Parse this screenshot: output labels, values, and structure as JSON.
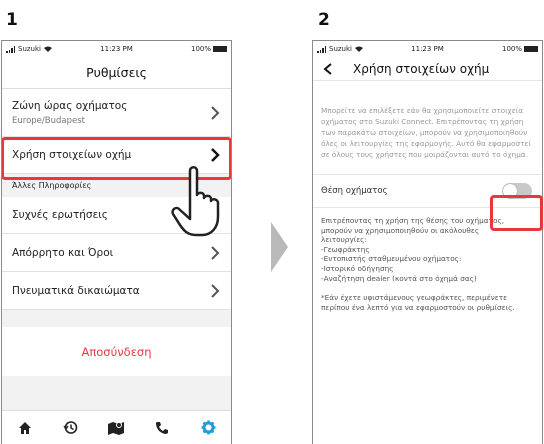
{
  "steps": [
    "1",
    "2"
  ],
  "status_bar": {
    "carrier": "Suzuki",
    "time": "11:23 PM",
    "battery": "100%"
  },
  "screen1": {
    "title": "Ρυθμίσεις",
    "timezone": {
      "label": "Ζώνη ώρας οχήματος",
      "value": "Europe/Budapest"
    },
    "vehicle_data": {
      "label": "Χρήση στοιχείων οχήμ"
    },
    "section_label": "Άλλες Πληροφορίες",
    "items": [
      {
        "label": "Συχνές ερωτήσεις"
      },
      {
        "label": "Απόρρητο και Όροι"
      },
      {
        "label": "Πνευματικά δικαιώματα"
      }
    ],
    "logout": "Αποσύνδεση",
    "tabs": [
      "home-icon",
      "history-icon",
      "map-icon",
      "phone-icon",
      "settings-icon"
    ],
    "colors": {
      "accent": "#e8383d",
      "active_tab": "#1aa0d8"
    }
  },
  "screen2": {
    "title": "Χρήση στοιχείων οχήμ",
    "intro": "Μπορείτε να επιλέξετε εάν θα χρησιμοποιείτε στοιχεία οχήματος στο Suzuki Connect. Επιτρέποντας τη χρήση των παρακάτω στοιχείων, μπορούν να χρησιμοποιηθούν όλες οι λειτουργίες της εφαρμογής. Αυτό θα εφαρμοστεί σε όλους τους χρήστες που μοιράζονται αυτό το όχημα.",
    "toggle_label": "Θέση οχήματος",
    "toggle_on": false,
    "body_lines": [
      "Επιτρέποντας τη χρήση της θέσης του οχήματος,",
      "μπορούν να χρησιμοποιηθούν οι ακόλουθες",
      "λειτουργίες:",
      "-Γεωφράκτης",
      "-Εντοπιστής σταθμευμένου οχήματος:",
      "-Ιστορικό οδήγησης",
      "-Αναζήτηση dealer (κοντά στο όχημά σας)"
    ],
    "note": "*Εάν έχετε υφιστάμενους γεωφράκτες, περιμένετε περίπου ένα λεπτό για να εφαρμοστούν οι ρυθμίσεις."
  }
}
